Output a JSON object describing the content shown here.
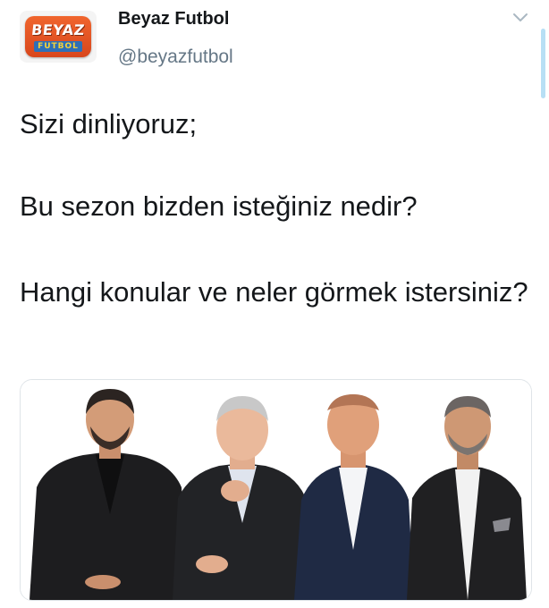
{
  "tweet": {
    "avatar": {
      "logo_line1": "BEYAZ",
      "logo_line2": "FUTBOL"
    },
    "author_name": "Beyaz Futbol",
    "author_handle": "@beyazfutbol",
    "text_lines": [
      "Sizi dinliyoruz;",
      "Bu sezon bizden isteğiniz nedir?",
      "Hangi konular ve neler görmek istersiniz?"
    ],
    "media": {
      "people_count": 4
    }
  },
  "colors": {
    "text": "#14171a",
    "secondary": "#657786",
    "logo_orange": "#e8562a",
    "logo_blue": "#2e6fb6"
  },
  "icons": {
    "menu": "chevron-down-icon"
  }
}
